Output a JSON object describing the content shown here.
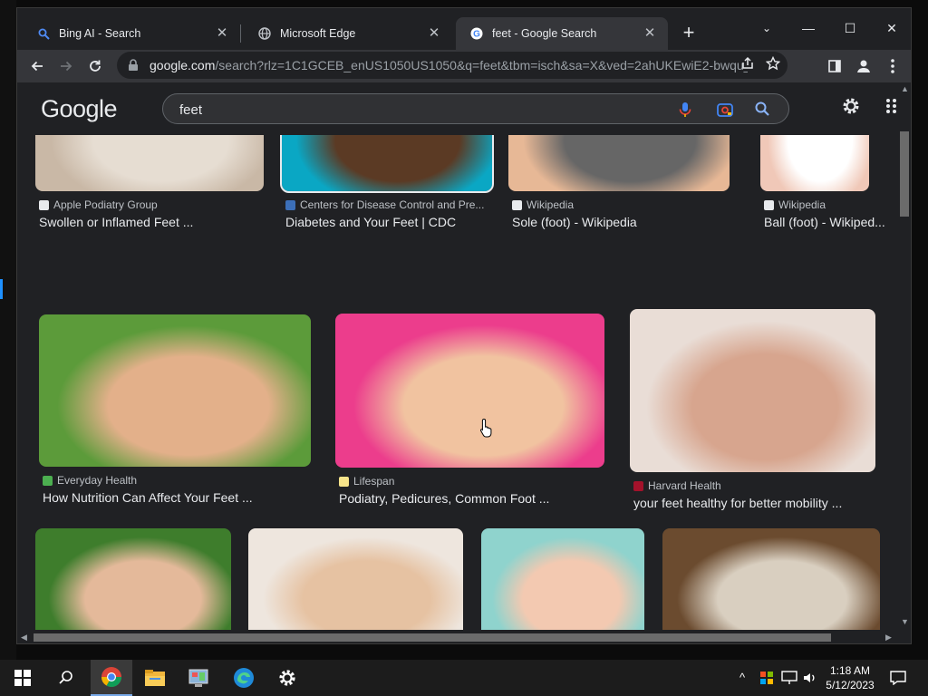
{
  "window": {
    "tabs": [
      {
        "label": "Bing AI - Search",
        "icon": "search-icon"
      },
      {
        "label": "Microsoft Edge",
        "icon": "globe-icon"
      },
      {
        "label": "feet - Google Search",
        "icon": "google-icon",
        "active": true
      }
    ],
    "controls": {
      "minimize": "—",
      "maximize": "☐",
      "close": "✕"
    }
  },
  "toolbar": {
    "url_host": "google.com",
    "url_path": "/search?rlz=1C1GCEB_enUS1050US1050&q=feet&tbm=isch&sa=X&ved=2ahUKEwiE2-bwqu_-..."
  },
  "google": {
    "logo": "Google",
    "query": "feet"
  },
  "results": [
    {
      "source": "Apple Podiatry Group",
      "title": "Swollen or Inflamed Feet ...",
      "fav": "#e8eaed",
      "c1": "#c9b8a6",
      "c2": "#e6ddd2"
    },
    {
      "source": "Centers for Disease Control and Pre...",
      "title": "Diabetes and Your Feet | CDC",
      "fav": "#3c6fb8",
      "c1": "#0aa7c4",
      "c2": "#5b3a24"
    },
    {
      "source": "Wikipedia",
      "title": "Sole (foot) - Wikipedia",
      "fav": "#e8eaed",
      "c1": "#e7b896",
      "c2": "#666"
    },
    {
      "source": "Wikipedia",
      "title": "Ball (foot) - Wikiped...",
      "fav": "#e8eaed",
      "c1": "#f0c8b8",
      "c2": "#fff"
    },
    {
      "source": "Everyday Health",
      "title": "How Nutrition Can Affect Your Feet ...",
      "fav": "#4caf50",
      "c1": "#5c9b3a",
      "c2": "#e3b08a"
    },
    {
      "source": "Lifespan",
      "title": "Podiatry, Pedicures, Common Foot ...",
      "fav": "#f6e38a",
      "c1": "#ec3d8c",
      "c2": "#f1c3a0"
    },
    {
      "source": "Harvard Health",
      "title": "your feet healthy for better mobility ...",
      "fav": "#a3122b",
      "c1": "#e9ddd6",
      "c2": "#d7a58e"
    },
    {
      "c1": "#3e7d2c",
      "c2": "#e4b99a"
    },
    {
      "c1": "#eee6de",
      "c2": "#e6c2a2"
    },
    {
      "c1": "#8fd3cd",
      "c2": "#f3c9b1"
    },
    {
      "c1": "#6b4b2f",
      "c2": "#d9cfc0"
    }
  ],
  "taskbar": {
    "time": "1:18 AM",
    "date": "5/12/2023"
  }
}
